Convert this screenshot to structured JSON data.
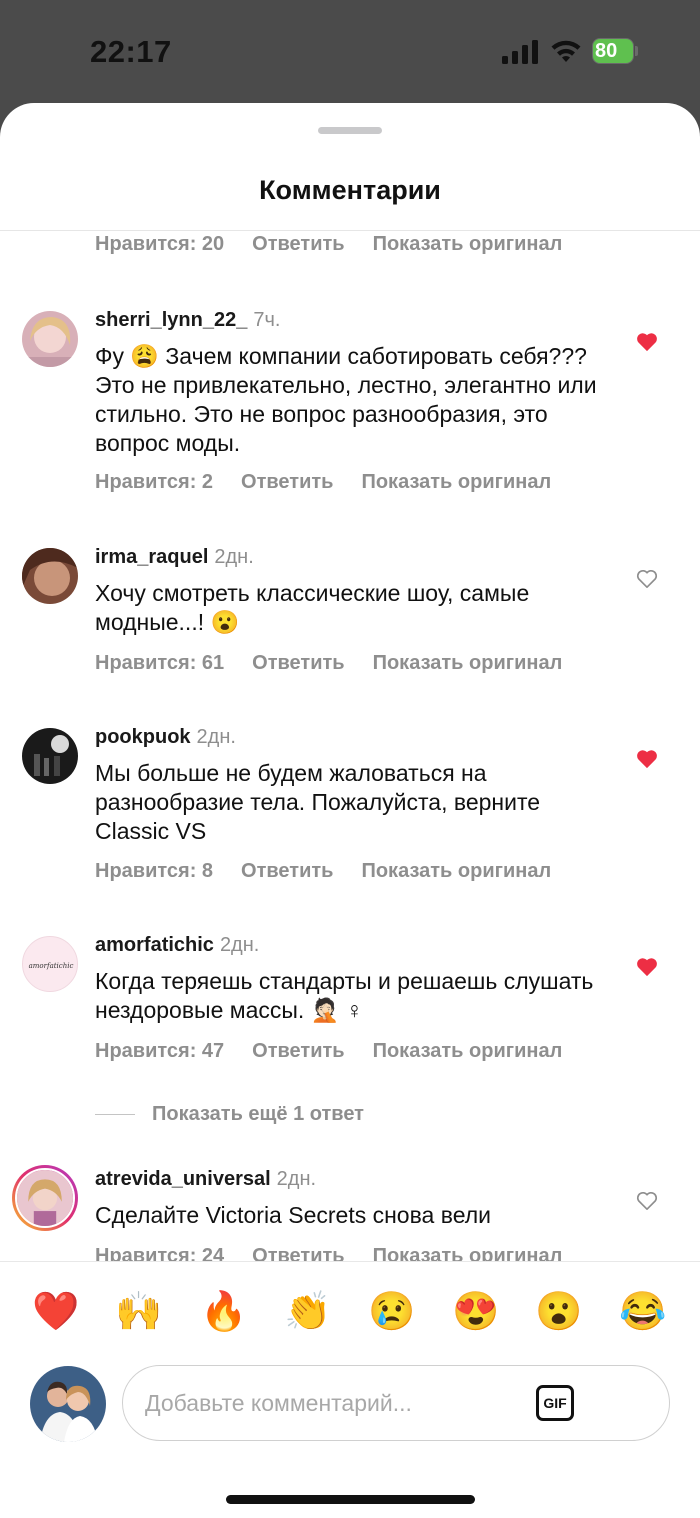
{
  "status_bar": {
    "time": "22:17",
    "battery": "80",
    "battery_color": "#5fc04f",
    "icons": [
      "signal-icon",
      "wifi-icon",
      "battery-charging-icon"
    ]
  },
  "sheet": {
    "title": "Комментарии"
  },
  "labels": {
    "reply": "Ответить",
    "show_original": "Показать оригинал"
  },
  "top_partial": {
    "likes": "Нравится: 20"
  },
  "comments": [
    {
      "user": "sherri_lynn_22_",
      "age": "7ч.",
      "text": "Фу 😩 Зачем компании саботировать себя??? Это не привлекательно, лестно, элегантно или стильно. Это не вопрос разнообразия, это вопрос моды.",
      "likes": "Нравится: 2",
      "liked": true
    },
    {
      "user": "irma_raquel",
      "age": "2дн.",
      "text": "Хочу смотреть классические шоу, самые модные...! 😮",
      "likes": "Нравится: 61",
      "liked": false
    },
    {
      "user": "pookpuok",
      "age": "2дн.",
      "text": "Мы больше не будем жаловаться на разнообразие тела. Пожалуйста, верните Classic VS",
      "likes": "Нравится: 8",
      "liked": true
    },
    {
      "user": "amorfatichic",
      "age": "2дн.",
      "text": "Когда теряешь стандарты и решаешь слушать нездоровые массы. 🤦🏻 ♀",
      "likes": "Нравится: 47",
      "liked": true,
      "avatar_text": "amorfatichic"
    },
    {
      "user": "atrevida_universal",
      "age": "2дн.",
      "text": "Сделайте Victoria Secrets снова вели",
      "likes": "Нравится: 24",
      "liked": false
    }
  ],
  "more_replies": "Показать ещё 1 ответ",
  "reactions": [
    "❤️",
    "🙌",
    "🔥",
    "👏",
    "😢",
    "😍",
    "😮",
    "😂"
  ],
  "composer": {
    "placeholder": "Добавьте комментарий...",
    "gif_label": "GIF"
  },
  "colors": {
    "liked_heart": "#ed2e44",
    "muted_text": "#8e8e8e"
  }
}
